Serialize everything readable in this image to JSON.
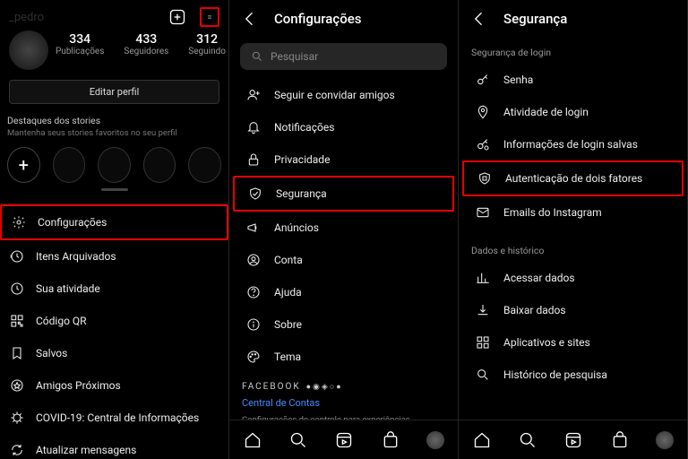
{
  "panel1": {
    "username": "_pedro",
    "subname": "",
    "stats": [
      {
        "num": "334",
        "label": "Publicações"
      },
      {
        "num": "433",
        "label": "Seguidores"
      },
      {
        "num": "312",
        "label": "Seguindo"
      }
    ],
    "edit": "Editar perfil",
    "stories_title": "Destaques dos stories",
    "stories_sub": "Mantenha seus stories favoritos no seu perfil",
    "menu": [
      {
        "icon": "gear",
        "label": "Configurações",
        "hl": true
      },
      {
        "icon": "clock-arrow",
        "label": "Itens Arquivados"
      },
      {
        "icon": "clock",
        "label": "Sua atividade"
      },
      {
        "icon": "qr",
        "label": "Código QR"
      },
      {
        "icon": "bookmark",
        "label": "Salvos"
      },
      {
        "icon": "star-list",
        "label": "Amigos Próximos"
      },
      {
        "icon": "covid",
        "label": "COVID-19: Central de Informações"
      },
      {
        "icon": "refresh-msg",
        "label": "Atualizar mensagens"
      }
    ]
  },
  "panel2": {
    "title": "Configurações",
    "search": "Pesquisar",
    "items": [
      {
        "icon": "person-plus",
        "label": "Seguir e convidar amigos"
      },
      {
        "icon": "bell",
        "label": "Notificações"
      },
      {
        "icon": "lock",
        "label": "Privacidade"
      },
      {
        "icon": "shield",
        "label": "Segurança",
        "hl": true
      },
      {
        "icon": "megaphone",
        "label": "Anúncios"
      },
      {
        "icon": "user-circle",
        "label": "Conta"
      },
      {
        "icon": "help",
        "label": "Ajuda"
      },
      {
        "icon": "info",
        "label": "Sobre"
      },
      {
        "icon": "palette",
        "label": "Tema"
      }
    ],
    "fb_brand": "FACEBOOK",
    "fb_link": "Central de Contas",
    "fb_desc": "Configurações de controle para experiências conectadas no Instagram, no aplicativo do Facebook e no Messenger, incluindo o compartilhamento de stories e publicações e o login."
  },
  "panel3": {
    "title": "Segurança",
    "sec1": "Segurança de login",
    "items1": [
      {
        "icon": "key",
        "label": "Senha"
      },
      {
        "icon": "location",
        "label": "Atividade de login"
      },
      {
        "icon": "key-save",
        "label": "Informações de login salvas"
      },
      {
        "icon": "shield-grid",
        "label": "Autenticação de dois fatores",
        "hl": true
      },
      {
        "icon": "mail",
        "label": "Emails do Instagram"
      }
    ],
    "sec2": "Dados e histórico",
    "items2": [
      {
        "icon": "bar-chart",
        "label": "Acessar dados"
      },
      {
        "icon": "download",
        "label": "Baixar dados"
      },
      {
        "icon": "apps",
        "label": "Aplicativos e sites"
      },
      {
        "icon": "search",
        "label": "Histórico de pesquisa"
      }
    ]
  }
}
